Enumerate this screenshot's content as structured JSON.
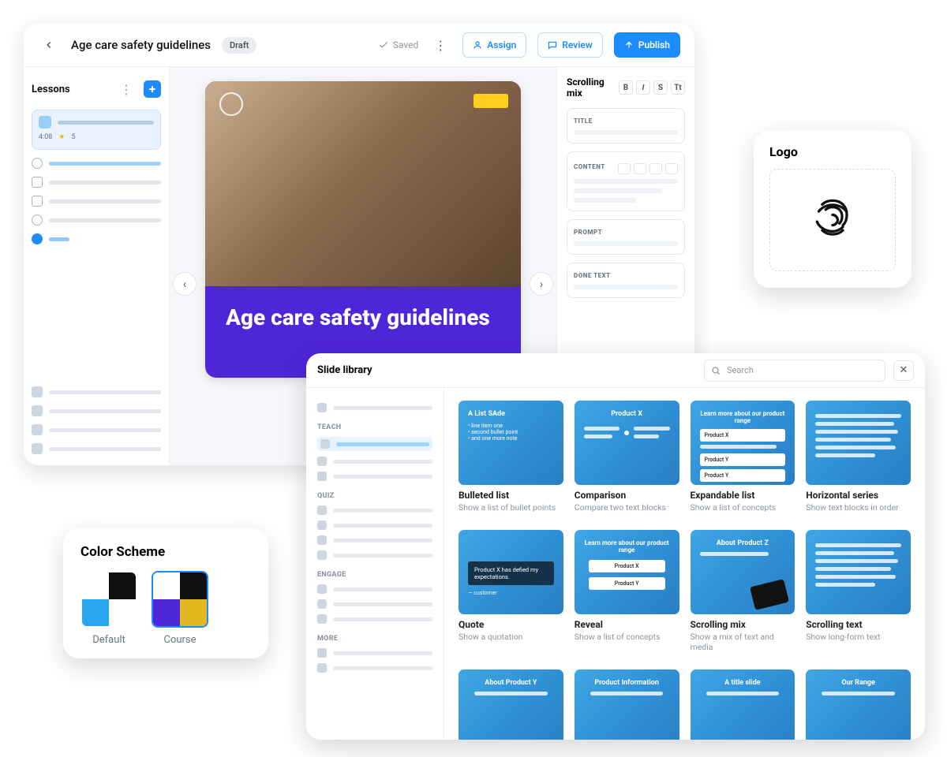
{
  "editor": {
    "title": "Age care safety guidelines",
    "status": "Draft",
    "saved": "Saved",
    "actions": {
      "assign": "Assign",
      "review": "Review",
      "publish": "Publish"
    }
  },
  "lessons": {
    "title": "Lessons",
    "card_meta": {
      "a": "4:08",
      "b": "5"
    }
  },
  "slide": {
    "title": "Age care safety guidelines"
  },
  "props": {
    "name": "Scrolling mix",
    "fields": {
      "title": "TITLE",
      "content": "CONTENT",
      "prompt": "PROMPT",
      "done": "DONE TEXT"
    }
  },
  "logo_card": {
    "title": "Logo"
  },
  "color_scheme": {
    "title": "Color Scheme",
    "items": [
      {
        "label": "Default",
        "colors": [
          "#ffffff",
          "#0f0f0f",
          "#2aa5f0",
          "#ffffff"
        ],
        "selected": false
      },
      {
        "label": "Course",
        "colors": [
          "#ffffff",
          "#0f0f0f",
          "#4f25d8",
          "#e3b81f"
        ],
        "selected": true
      }
    ]
  },
  "library": {
    "title": "Slide library",
    "search_placeholder": "Search",
    "groups": [
      {
        "label": "TEACH",
        "count": 3
      },
      {
        "label": "QUIZ",
        "count": 4
      },
      {
        "label": "ENGAGE",
        "count": 3
      },
      {
        "label": "MORE",
        "count": 2
      }
    ],
    "templates": [
      {
        "title": "Bulleted list",
        "sub": "Show a list of bullet points",
        "preview_title": "A List SAde"
      },
      {
        "title": "Comparison",
        "sub": "Compare two text blocks",
        "preview_title": "Product X"
      },
      {
        "title": "Expandable list",
        "sub": "Show a list of concepts",
        "preview_title": "Learn more about our product range"
      },
      {
        "title": "Horizontal series",
        "sub": "Show text blocks in order",
        "preview_title": ""
      },
      {
        "title": "Quote",
        "sub": "Show a quotation",
        "preview_title": "Product X has defied my expectations."
      },
      {
        "title": "Reveal",
        "sub": "Show a list of concepts",
        "preview_title": "Learn more about our product range"
      },
      {
        "title": "Scrolling mix",
        "sub": "Show a mix of text and media",
        "preview_title": "About Product Z"
      },
      {
        "title": "Scrolling text",
        "sub": "Show long-form text",
        "preview_title": ""
      },
      {
        "title": "",
        "sub": "",
        "preview_title": "About Product Y"
      },
      {
        "title": "",
        "sub": "",
        "preview_title": "Product Information"
      },
      {
        "title": "",
        "sub": "",
        "preview_title": "A title slide"
      },
      {
        "title": "",
        "sub": "",
        "preview_title": "Our Range"
      }
    ],
    "extra_labels": {
      "productX": "Product X",
      "productY": "Product Y"
    }
  }
}
